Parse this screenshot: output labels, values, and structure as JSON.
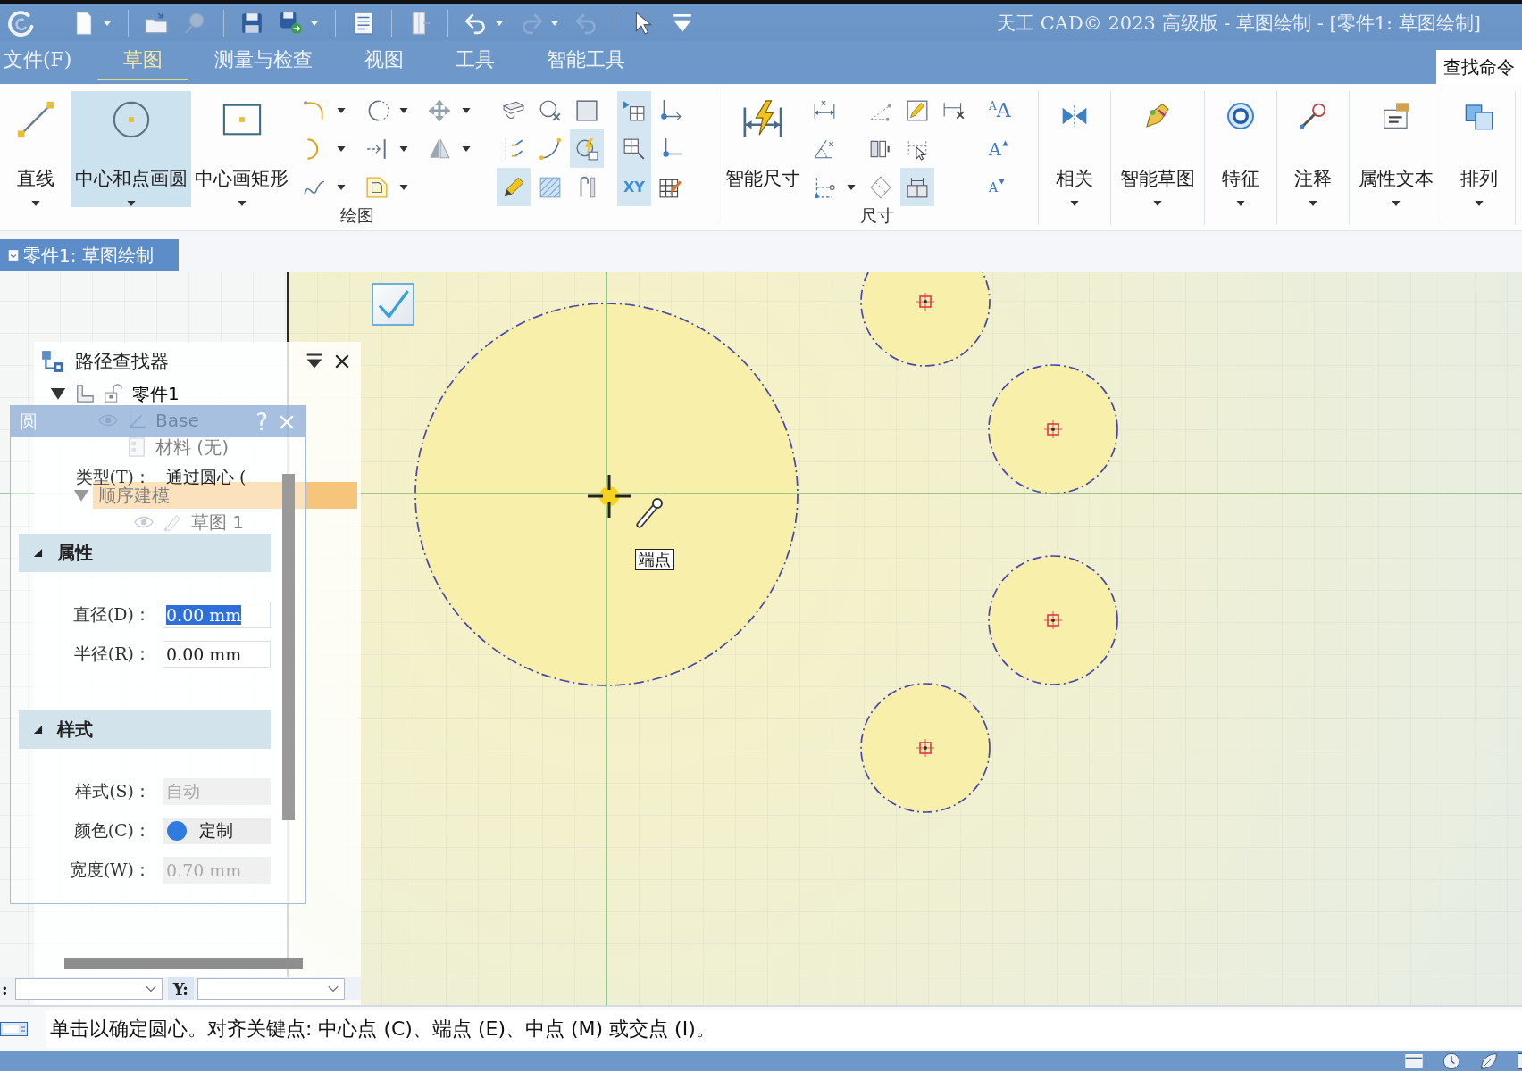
{
  "title_bar": {
    "title": "天工 CAD© 2023 高级版 - 草图绘制 - [零件1: 草图绘制]"
  },
  "quick_access": [
    {
      "disabled": false,
      "has_menu": true
    },
    {
      "disabled": false,
      "has_menu": false
    },
    {
      "disabled": true,
      "has_menu": false
    },
    {
      "disabled": false,
      "has_menu": false
    },
    {
      "disabled": false,
      "has_menu": true
    },
    {
      "disabled": false,
      "has_menu": false
    },
    {
      "disabled": false,
      "has_menu": false
    },
    {
      "disabled": false,
      "has_menu": true
    },
    {
      "disabled": true,
      "has_menu": true
    },
    {
      "disabled": true,
      "has_menu": false
    },
    {
      "disabled": false,
      "has_menu": false
    },
    {
      "disabled": false,
      "has_menu": false
    }
  ],
  "menu_tabs": [
    {
      "label": "文件(F)",
      "selected": false
    },
    {
      "label": "草图",
      "selected": true
    },
    {
      "label": "测量与检查",
      "selected": false
    },
    {
      "label": "视图",
      "selected": false
    },
    {
      "label": "工具",
      "selected": false
    },
    {
      "label": "智能工具",
      "selected": false
    }
  ],
  "find_command": {
    "label": "查找命令"
  },
  "ribbon": {
    "groups": [
      {
        "label": "绘图",
        "large_tools": [
          {
            "label": "直线",
            "selected": false,
            "has_menu": true
          },
          {
            "label": "中心和点画圆",
            "selected": true,
            "has_menu": true
          },
          {
            "label": "中心画矩形",
            "selected": false,
            "has_menu": true
          }
        ],
        "tool_sets": [
          {
            "tools": [
              {
                "selected": false,
                "has_menu": true
              },
              {
                "selected": false,
                "has_menu": true
              },
              {
                "selected": false,
                "has_menu": true
              },
              {
                "selected": false,
                "has_menu": true
              },
              {
                "selected": false,
                "has_menu": true
              },
              {
                "selected": false,
                "has_menu": true
              },
              {
                "selected": false,
                "has_menu": true
              },
              {
                "selected": false,
                "has_menu": true
              }
            ]
          },
          {
            "tools": [
              {
                "selected": false,
                "has_menu": false
              },
              {
                "selected": false,
                "has_menu": false
              },
              {
                "selected": true,
                "has_menu": false
              },
              {
                "selected": false,
                "has_menu": false
              },
              {
                "selected": false,
                "has_menu": false
              },
              {
                "selected": false,
                "has_menu": false
              },
              {
                "selected": false,
                "has_menu": false
              },
              {
                "selected": true,
                "has_menu": false
              },
              {
                "selected": false,
                "has_menu": false
              }
            ]
          },
          {
            "tools": [
              {
                "selected": true,
                "has_menu": false
              },
              {
                "selected": true,
                "has_menu": false
              },
              {
                "label": "XY",
                "selected": true,
                "has_menu": false
              },
              {
                "selected": false,
                "has_menu": false
              },
              {
                "selected": false,
                "has_menu": false
              },
              {
                "selected": false,
                "has_menu": false
              }
            ]
          }
        ]
      },
      {
        "label": "尺寸",
        "large_tools": [
          {
            "label": "智能尺寸",
            "selected": false,
            "has_menu": false
          }
        ],
        "tool_sets": [
          {
            "tools": [
              {
                "selected": false,
                "has_menu": false
              },
              {
                "selected": false,
                "has_menu": false
              },
              {
                "selected": false,
                "has_menu": true
              },
              {
                "selected": false,
                "has_menu": false
              },
              {
                "selected": false,
                "has_menu": false
              },
              {
                "selected": false,
                "has_menu": false
              },
              {
                "selected": false,
                "has_menu": false
              },
              {
                "selected": false,
                "has_menu": false
              },
              {
                "selected": true,
                "has_menu": false
              },
              {
                "selected": false,
                "has_menu": false
              }
            ]
          }
        ],
        "text_tools": [
          {
            "label": "$^{A}$A",
            "kind": "style"
          },
          {
            "label": "A",
            "kind": "grow"
          },
          {
            "label": "A",
            "kind": "shrink"
          }
        ]
      },
      {
        "large_tools": [
          {
            "label": "相关",
            "selected": false,
            "has_menu": true
          }
        ]
      },
      {
        "large_tools": [
          {
            "label": "智能草图",
            "selected": false,
            "has_menu": true
          }
        ]
      },
      {
        "large_tools": [
          {
            "label": "特征",
            "selected": false,
            "has_menu": true
          }
        ]
      },
      {
        "large_tools": [
          {
            "label": "注释",
            "selected": false,
            "has_menu": true
          }
        ]
      },
      {
        "large_tools": [
          {
            "label": "属性文本",
            "selected": false,
            "has_menu": true
          }
        ]
      },
      {
        "large_tools": [
          {
            "label": "排列",
            "selected": false,
            "has_menu": true
          }
        ]
      }
    ]
  },
  "document_tabs": [
    {
      "label": "零件1: 草图绘制",
      "selected": true
    }
  ],
  "pathfinder": {
    "title": "路径查找器",
    "tree": [
      {
        "label": "零件1",
        "kind": "part",
        "expanded": true,
        "selected": false,
        "children": [
          {
            "label": "Base",
            "kind": "coordinate_system",
            "selected": false
          },
          {
            "label": "材料 (无)",
            "kind": "material",
            "selected": false
          },
          {
            "label": "顺序建模",
            "kind": "folder",
            "expanded": true,
            "selected": true,
            "children": [
              {
                "label": "草图 1",
                "kind": "sketch",
                "selected": false
              }
            ]
          }
        ]
      }
    ]
  },
  "circle_dialog": {
    "title": "圆",
    "help": "?",
    "type_field": {
      "label": "类型(T)：",
      "value": "通过圆心 ("
    },
    "sections": [
      {
        "title": "属性",
        "expanded": true,
        "fields": [
          {
            "label": "直径(D)：",
            "value": "0.00 mm",
            "kind": "text",
            "text_selected": true,
            "disabled": false
          },
          {
            "label": "半径(R)：",
            "value": "0.00 mm",
            "kind": "text",
            "text_selected": false,
            "disabled": false
          }
        ]
      },
      {
        "title": "样式",
        "expanded": true,
        "fields": [
          {
            "label": "样式(S)：",
            "value": "自动",
            "kind": "text",
            "text_selected": false,
            "disabled": true
          },
          {
            "label": "颜色(C)：",
            "value": "定制",
            "kind": "color",
            "color": "#2f7be0",
            "disabled": false
          },
          {
            "label": "宽度(W)：",
            "value": "0.70 mm",
            "kind": "text",
            "text_selected": false,
            "disabled": true
          }
        ]
      }
    ]
  },
  "coordinates": {
    "x_label": ":",
    "y_label": "Y:"
  },
  "canvas": {
    "snap_tooltip": "端点"
  },
  "status_bar": {
    "message": "单击以确定圆心。对齐关键点: 中心点 (C)、端点 (E)、中点 (M) 或交点 (I)。"
  }
}
